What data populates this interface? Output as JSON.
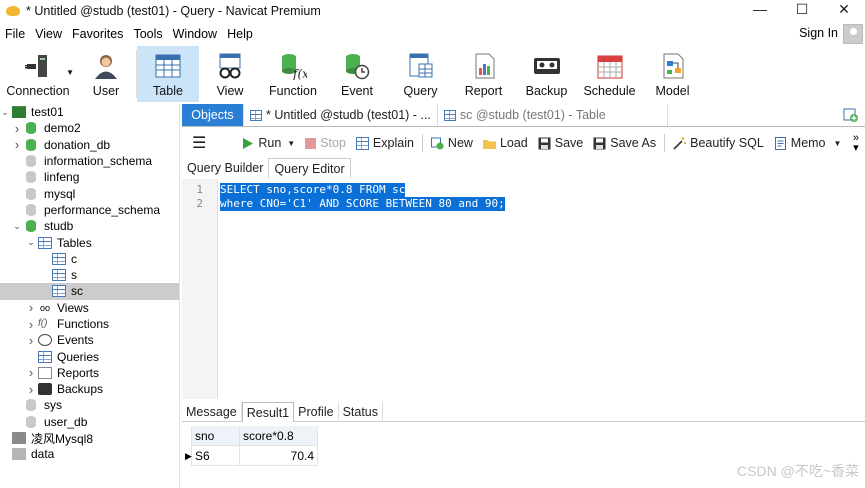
{
  "window": {
    "title": "* Untitled @studb (test01) - Query - Navicat Premium",
    "minimize": "—",
    "maximize": "☐",
    "close": "✕"
  },
  "menu": [
    "File",
    "View",
    "Favorites",
    "Tools",
    "Window",
    "Help"
  ],
  "account": {
    "sign_in": "Sign In"
  },
  "toolbar": [
    {
      "label": "Connection",
      "icon": "connection-icon"
    },
    {
      "label": "User",
      "icon": "user-icon"
    },
    {
      "label": "Table",
      "icon": "table-icon",
      "active": true
    },
    {
      "label": "View",
      "icon": "view-icon"
    },
    {
      "label": "Function",
      "icon": "function-icon"
    },
    {
      "label": "Event",
      "icon": "event-icon"
    },
    {
      "label": "Query",
      "icon": "query-icon"
    },
    {
      "label": "Report",
      "icon": "report-icon"
    },
    {
      "label": "Backup",
      "icon": "backup-icon"
    },
    {
      "label": "Schedule",
      "icon": "schedule-icon"
    },
    {
      "label": "Model",
      "icon": "model-icon"
    }
  ],
  "tree": {
    "connection": "test01",
    "dbs_top": [
      "demo2",
      "donation_db",
      "information_schema",
      "linfeng",
      "mysql",
      "performance_schema"
    ],
    "studb": "studb",
    "tables_label": "Tables",
    "tables": [
      "c",
      "s",
      "sc"
    ],
    "objects": [
      "Views",
      "Functions",
      "Events",
      "Queries",
      "Reports",
      "Backups"
    ],
    "dbs_bottom": [
      "sys",
      "user_db"
    ],
    "connections_other": [
      "凌风Mysql8",
      "data"
    ]
  },
  "doc_tabs": {
    "objects": "Objects",
    "query_tab": "* Untitled @studb (test01) - ...",
    "table_tab": "sc @studb (test01) - Table"
  },
  "sql_toolbar": {
    "run": "Run",
    "stop": "Stop",
    "explain": "Explain",
    "new": "New",
    "load": "Load",
    "save": "Save",
    "save_as": "Save As",
    "beautify": "Beautify SQL",
    "memo": "Memo"
  },
  "sub_tabs": {
    "builder": "Query Builder",
    "editor": "Query Editor"
  },
  "editor": {
    "lines": [
      {
        "no": "1",
        "text": "SELECT sno,score*0.8 FROM sc"
      },
      {
        "no": "2",
        "text": "where CNO='C1' AND SCORE BETWEEN 80 and 90;"
      }
    ]
  },
  "result_tabs": [
    "Message",
    "Result1",
    "Profile",
    "Status"
  ],
  "result": {
    "columns": [
      "sno",
      "score*0.8"
    ],
    "rows": [
      [
        "S6",
        "70.4"
      ]
    ]
  },
  "watermark": "CSDN @不吃~香菜",
  "colors": {
    "accent": "#2a7ed5",
    "selection": "#0a6fd6",
    "toolbar_active": "#cce4f7"
  }
}
